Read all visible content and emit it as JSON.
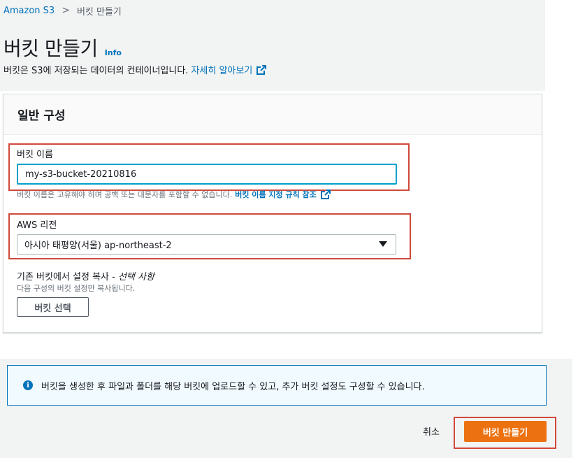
{
  "breadcrumb": {
    "root": "Amazon S3",
    "separator": ">",
    "current": "버킷 만들기"
  },
  "header": {
    "title": "버킷 만들기",
    "info_link": "Info",
    "description": "버킷은 S3에 저장되는 데이터의 컨테이너입니다.",
    "learn_more": "자세히 알아보기",
    "learn_more_icon": "external-link-icon"
  },
  "general_config": {
    "title": "일반 구성",
    "bucket_name": {
      "label": "버킷 이름",
      "value": "my-s3-bucket-20210816",
      "hint": "버킷 이름은 고유해야 하며 공백 또는 대문자를 포함할 수 없습니다.",
      "hint_link": "버킷 이름 지정 규칙 참조"
    },
    "region": {
      "label": "AWS 리전",
      "selected": "아시아 태평양(서울) ap-northeast-2"
    },
    "copy_settings": {
      "label": "기존 버킷에서 설정 복사 - ",
      "optional": "선택 사항",
      "description": "다음 구성의 버킷 설정만 복사됩니다.",
      "button": "버킷 선택"
    }
  },
  "alert": {
    "icon": "info-icon",
    "text": "버킷을 생성한 후 파일과 폴더를 해당 버킷에 업로드할 수 있고, 추가 버킷 설정도 구성할 수 있습니다."
  },
  "footer": {
    "cancel": "취소",
    "create": "버킷 만들기"
  },
  "colors": {
    "accent": "#ec7211",
    "link": "#0073bb",
    "annotation": "#d0493a"
  }
}
